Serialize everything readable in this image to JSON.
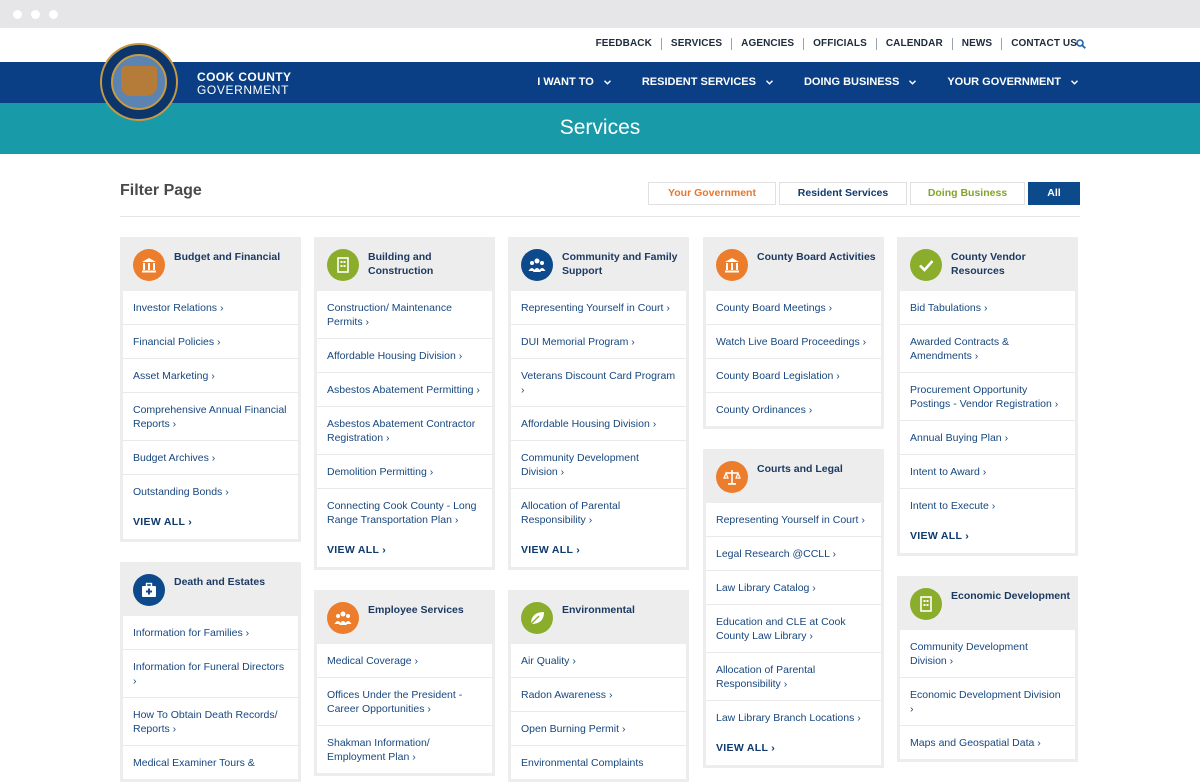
{
  "util_nav": {
    "links": [
      "FEEDBACK",
      "SERVICES",
      "AGENCIES",
      "OFFICIALS",
      "CALENDAR",
      "NEWS",
      "CONTACT US"
    ],
    "search_icon": "search-icon"
  },
  "brand": {
    "line1": "COOK COUNTY",
    "line2": "GOVERNMENT"
  },
  "main_nav": {
    "items": [
      "I WANT TO",
      "RESIDENT SERVICES",
      "DOING BUSINESS",
      "YOUR GOVERNMENT"
    ]
  },
  "page": {
    "title": "Services"
  },
  "filter": {
    "title": "Filter Page",
    "tabs": [
      {
        "label": "Your Government",
        "color": "#e8772e"
      },
      {
        "label": "Resident Services",
        "color": "#0f3a6d"
      },
      {
        "label": "Doing Business",
        "color": "#80a52a"
      },
      {
        "label": "All",
        "color": "#ffffff"
      }
    ]
  },
  "colors": {
    "orange": "#ec7d2c",
    "green": "#8bad2c",
    "blue": "#0d4a8c",
    "nav": "#0b3f85",
    "teal": "#189aa8"
  },
  "columns": [
    [
      {
        "title": "Budget and Financial",
        "icon": "building-columns-icon",
        "color": "orange",
        "items": [
          "Investor Relations ›",
          "Financial Policies ›",
          "Asset Marketing ›",
          "Comprehensive Annual Financial Reports ›",
          "Budget Archives ›",
          "Outstanding Bonds ›"
        ],
        "view_all": "VIEW ALL ›"
      },
      {
        "title": "Death and Estates",
        "icon": "medical-kit-icon",
        "color": "blue",
        "items": [
          "Information for Families ›",
          "Information for Funeral Directors ›",
          "How To Obtain Death Records/ Reports ›",
          "Medical Examiner Tours &"
        ],
        "view_all": ""
      }
    ],
    [
      {
        "title": "Building and Construction",
        "icon": "building-icon",
        "color": "green",
        "items": [
          "Construction/ Maintenance Permits ›",
          "Affordable Housing Division ›",
          "Asbestos Abatement Permitting ›",
          "Asbestos Abatement Contractor Registration ›",
          "Demolition Permitting ›",
          "Connecting Cook County - Long Range Transportation Plan ›"
        ],
        "view_all": "VIEW ALL ›"
      },
      {
        "title": "Employee Services",
        "icon": "people-group-icon",
        "color": "orange",
        "items": [
          "Medical Coverage ›",
          "Offices Under the President - Career Opportunities ›",
          "Shakman Information/ Employment Plan ›"
        ],
        "view_all": ""
      }
    ],
    [
      {
        "title": "Community and Family Support",
        "icon": "family-icon",
        "color": "blue",
        "items": [
          "Representing Yourself in Court ›",
          "DUI Memorial Program ›",
          "Veterans Discount Card Program ›",
          "Affordable Housing Division ›",
          "Community Development Division ›",
          "Allocation of Parental Responsibility ›"
        ],
        "view_all": "VIEW ALL ›"
      },
      {
        "title": "Environmental",
        "icon": "leaf-icon",
        "color": "green",
        "items": [
          "Air Quality ›",
          "Radon Awareness ›",
          "Open Burning Permit ›",
          "Environmental Complaints"
        ],
        "view_all": ""
      }
    ],
    [
      {
        "title": "County Board Activities",
        "icon": "building-columns-icon",
        "color": "orange",
        "items": [
          "County Board Meetings ›",
          "Watch Live Board Proceedings ›",
          "County Board Legislation ›",
          "County Ordinances ›"
        ],
        "view_all": ""
      },
      {
        "title": "Courts and Legal",
        "icon": "scales-icon",
        "color": "orange",
        "items": [
          "Representing Yourself in Court ›",
          "Legal Research @CCLL ›",
          "Law Library Catalog ›",
          "Education and CLE at Cook County Law Library ›",
          "Allocation of Parental Responsibility ›",
          "Law Library Branch Locations ›"
        ],
        "view_all": "VIEW ALL ›"
      }
    ],
    [
      {
        "title": "County Vendor Resources",
        "icon": "checkmark-icon",
        "color": "green",
        "items": [
          "Bid Tabulations ›",
          "Awarded Contracts & Amendments ›",
          "Procurement Opportunity Postings - Vendor Registration ›",
          "Annual Buying Plan ›",
          "Intent to Award ›",
          "Intent to Execute ›"
        ],
        "view_all": "VIEW ALL ›"
      },
      {
        "title": "Economic Development",
        "icon": "building-icon",
        "color": "green",
        "items": [
          "Community Development Division ›",
          "Economic Development Division ›",
          "Maps and Geospatial Data ›"
        ],
        "view_all": ""
      }
    ]
  ]
}
